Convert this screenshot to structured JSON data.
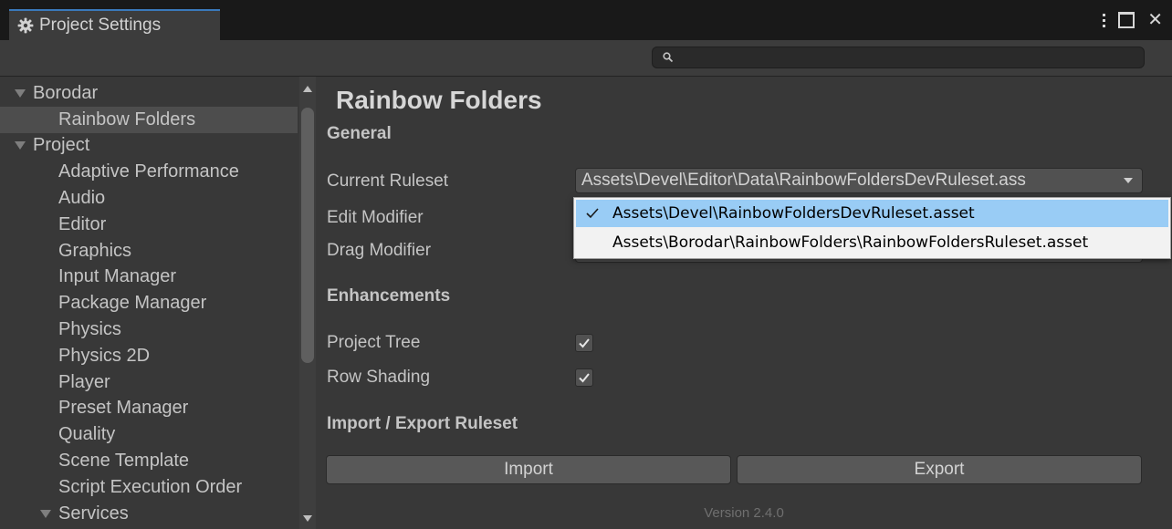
{
  "window": {
    "tab_title": "Project Settings",
    "tab_icon": "gear-icon",
    "controls": [
      "more-options-icon",
      "maximize-icon",
      "close-icon"
    ],
    "close_glyph": "✕"
  },
  "search": {
    "value": "",
    "placeholder": ""
  },
  "sidebar": {
    "items": [
      {
        "label": "Borodar",
        "level": 0,
        "expanded": true
      },
      {
        "label": "Rainbow Folders",
        "level": 1,
        "selected": true
      },
      {
        "label": "Project",
        "level": 0,
        "expanded": true
      },
      {
        "label": "Adaptive Performance",
        "level": 1
      },
      {
        "label": "Audio",
        "level": 1
      },
      {
        "label": "Editor",
        "level": 1
      },
      {
        "label": "Graphics",
        "level": 1
      },
      {
        "label": "Input Manager",
        "level": 1
      },
      {
        "label": "Package Manager",
        "level": 1
      },
      {
        "label": "Physics",
        "level": 1
      },
      {
        "label": "Physics 2D",
        "level": 1
      },
      {
        "label": "Player",
        "level": 1
      },
      {
        "label": "Preset Manager",
        "level": 1
      },
      {
        "label": "Quality",
        "level": 1
      },
      {
        "label": "Scene Template",
        "level": 1
      },
      {
        "label": "Script Execution Order",
        "level": 1
      },
      {
        "label": "Services",
        "level": 1,
        "expanded": true
      }
    ]
  },
  "main": {
    "title": "Rainbow Folders",
    "general_header": "General",
    "current_ruleset_label": "Current Ruleset",
    "current_ruleset_value": "Assets\\Devel\\Editor\\Data\\RainbowFoldersDevRuleset.ass",
    "edit_modifier_label": "Edit Modifier",
    "drag_modifier_label": "Drag Modifier",
    "enhancements_header": "Enhancements",
    "project_tree_label": "Project Tree",
    "project_tree_checked": true,
    "row_shading_label": "Row Shading",
    "row_shading_checked": true,
    "import_export_header": "Import / Export Ruleset",
    "import_button": "Import",
    "export_button": "Export",
    "version": "Version 2.4.0"
  },
  "ruleset_popup": {
    "options": [
      {
        "label": "Assets\\Devel\\RainbowFoldersDevRuleset.asset",
        "checked": true,
        "highlighted": true
      },
      {
        "label": "Assets\\Borodar\\RainbowFolders\\RainbowFoldersRuleset.asset",
        "checked": false,
        "highlighted": false
      }
    ]
  },
  "colors": {
    "accent": "#3a79bb",
    "background": "#383838",
    "popup_highlight": "#99ccf5"
  }
}
